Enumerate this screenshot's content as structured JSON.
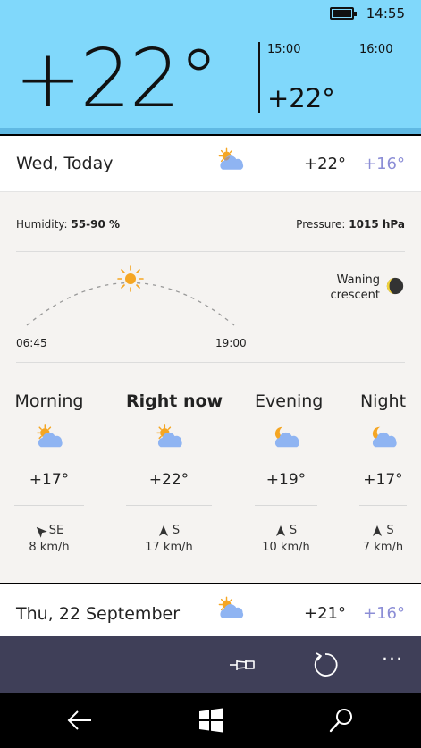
{
  "status": {
    "time": "14:55"
  },
  "current": {
    "temp": "+22°",
    "next_hours": [
      {
        "time": "15:00",
        "temp": "+22°"
      },
      {
        "time": "16:00",
        "temp": ""
      }
    ]
  },
  "today": {
    "label": "Wed, Today",
    "high": "+22°",
    "low": "+16°",
    "icon": "sun-cloud-icon"
  },
  "details": {
    "humidity_label": "Humidity:",
    "humidity_value": "55-90 %",
    "pressure_label": "Pressure:",
    "pressure_value": "1015 hPa",
    "sunrise": "06:45",
    "sunset": "19:00",
    "moon_line1": "Waning",
    "moon_line2": "crescent"
  },
  "periods": [
    {
      "name": "Morning",
      "temp": "+17°",
      "wind_dir": "SE",
      "wind_speed": "8 km/h",
      "icon": "sun-cloud-icon",
      "current": false
    },
    {
      "name": "Right now",
      "temp": "+22°",
      "wind_dir": "S",
      "wind_speed": "17 km/h",
      "icon": "sun-cloud-icon",
      "current": true
    },
    {
      "name": "Evening",
      "temp": "+19°",
      "wind_dir": "S",
      "wind_speed": "10 km/h",
      "icon": "moon-cloud-icon",
      "current": false
    },
    {
      "name": "Night",
      "temp": "+17°",
      "wind_dir": "S",
      "wind_speed": "7 km/h",
      "icon": "moon-cloud-icon",
      "current": false
    }
  ],
  "tomorrow": {
    "label": "Thu, 22 September",
    "high": "+21°",
    "low": "+16°",
    "icon": "sun-cloud-icon"
  },
  "app_bar": {
    "pin": "pin-icon",
    "refresh": "refresh-icon",
    "more": "···"
  },
  "colors": {
    "header": "#80d8fb",
    "app_bar": "#3f3f58",
    "low_temp": "#8c8ed6",
    "sun": "#f5a623",
    "cloud": "#8fb4f2"
  }
}
